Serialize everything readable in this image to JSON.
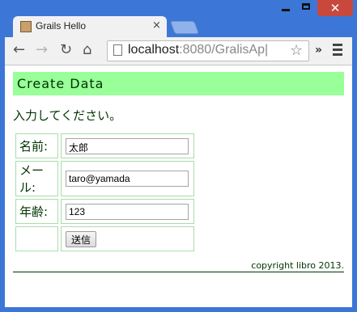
{
  "window": {
    "minimize_icon": "minimize-icon",
    "maximize_icon": "maximize-icon",
    "close_glyph": "✕"
  },
  "tab": {
    "title": "Grails Hello",
    "close_glyph": "×"
  },
  "toolbar": {
    "back_glyph": "←",
    "forward_glyph": "→",
    "reload_glyph": "↻",
    "home_glyph": "⌂",
    "url_host": "localhost",
    "url_rest": ":8080/GralisAp|",
    "star_glyph": "☆",
    "more_glyph": "»"
  },
  "page": {
    "header": "Create Data",
    "prompt": "入力してください。",
    "form": {
      "name_label": "名前:",
      "name_value": "太郎",
      "mail_label": "メール:",
      "mail_value": "taro@yamada",
      "age_label": "年齢:",
      "age_value": "123",
      "submit_label": "送信"
    },
    "copyright": "copyright libro 2013."
  },
  "colors": {
    "header_bg": "#99ff99",
    "text": "#003300",
    "cell_border": "#aaddaa",
    "title_bar": "#3c77d8",
    "close_button": "#c9483e"
  }
}
